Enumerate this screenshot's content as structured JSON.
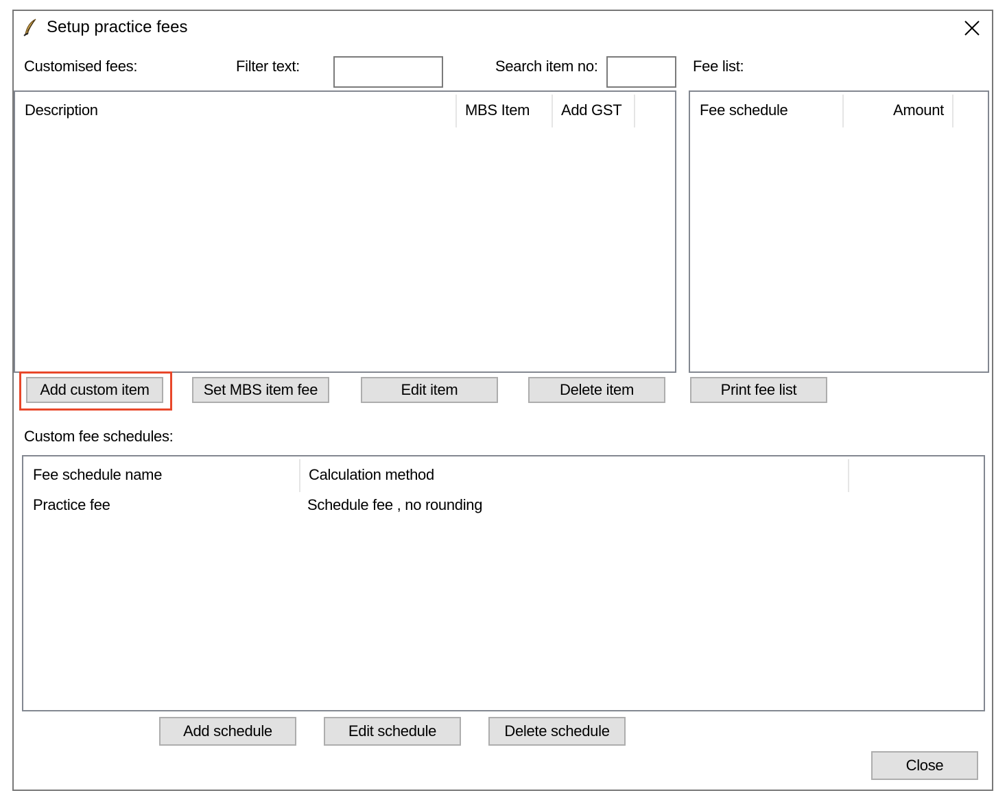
{
  "window": {
    "title": "Setup practice fees",
    "close_glyph": "✕"
  },
  "customised_fees": {
    "label": "Customised fees:",
    "filter_label": "Filter text:",
    "filter_value": "",
    "search_label": "Search item no:",
    "search_value": "",
    "columns": [
      "Description",
      "MBS Item",
      "Add GST"
    ],
    "rows": []
  },
  "fee_list": {
    "label": "Fee list:",
    "columns": [
      "Fee schedule",
      "Amount"
    ],
    "rows": []
  },
  "item_buttons": {
    "add_custom_item": "Add custom item",
    "set_mbs_item_fee": "Set MBS item fee",
    "edit_item": "Edit item",
    "delete_item": "Delete item",
    "print_fee_list": "Print fee list"
  },
  "custom_fee_schedules": {
    "label": "Custom fee schedules:",
    "columns": [
      "Fee schedule name",
      "Calculation method"
    ],
    "rows": [
      {
        "name": "Practice fee",
        "method": "Schedule fee , no rounding"
      }
    ]
  },
  "schedule_buttons": {
    "add_schedule": "Add schedule",
    "edit_schedule": "Edit schedule",
    "delete_schedule": "Delete schedule"
  },
  "footer": {
    "close": "Close"
  },
  "colors": {
    "highlight": "#e8472a",
    "button_bg": "#e1e1e1",
    "button_border": "#adadad"
  },
  "icons": {
    "app": "feather-icon",
    "close": "close-icon"
  }
}
